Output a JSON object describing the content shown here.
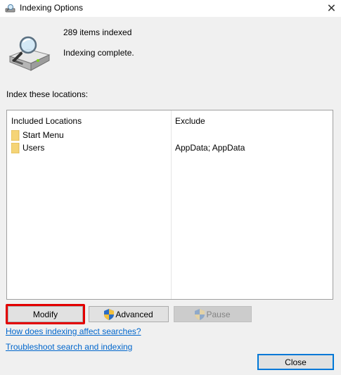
{
  "window": {
    "title": "Indexing Options"
  },
  "status": {
    "items_indexed": "289 items indexed",
    "state": "Indexing complete."
  },
  "locations": {
    "section_label": "Index these locations:",
    "headers": {
      "included": "Included Locations",
      "exclude": "Exclude"
    },
    "rows": [
      {
        "name": "Start Menu",
        "exclude": ""
      },
      {
        "name": "Users",
        "exclude": "AppData; AppData"
      }
    ]
  },
  "buttons": {
    "modify": "Modify",
    "advanced": "Advanced",
    "pause": "Pause",
    "close": "Close"
  },
  "links": {
    "affect": "How does indexing affect searches?",
    "troubleshoot": "Troubleshoot search and indexing"
  },
  "colors": {
    "highlight": "#e30000",
    "link": "#0066cc",
    "default_button_border": "#0078d7"
  },
  "icons": {
    "title": "indexing-options-icon",
    "drive": "drive-magnifier-icon",
    "folder": "folder-icon",
    "shield": "uac-shield-icon",
    "close": "close-icon"
  }
}
